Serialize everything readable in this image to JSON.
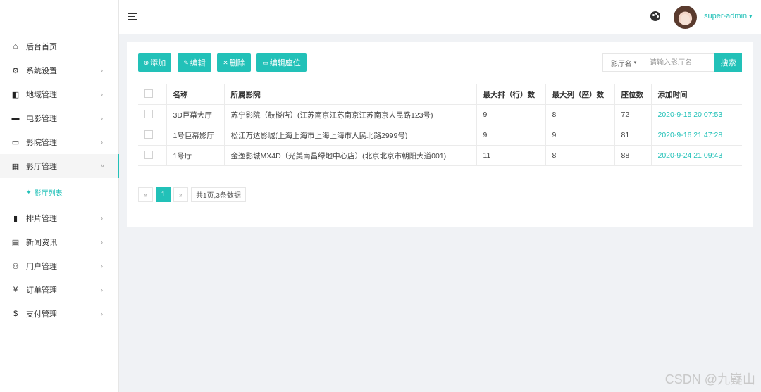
{
  "header": {
    "username": "super-admin",
    "username_caret": "▾"
  },
  "sidebar": {
    "items": [
      {
        "icon": "home-icon",
        "glyph": "⌂",
        "label": "后台首页",
        "arrow": ""
      },
      {
        "icon": "gear-icon",
        "glyph": "⚙",
        "label": "系统设置",
        "arrow": "›"
      },
      {
        "icon": "map-icon",
        "glyph": "◧",
        "label": "地域管理",
        "arrow": "›"
      },
      {
        "icon": "film-icon",
        "glyph": "▬",
        "label": "电影管理",
        "arrow": "›"
      },
      {
        "icon": "cinema-icon",
        "glyph": "▭",
        "label": "影院管理",
        "arrow": "›"
      },
      {
        "icon": "hall-icon",
        "glyph": "▦",
        "label": "影厅管理",
        "arrow": "˅"
      },
      {
        "icon": "schedule-icon",
        "glyph": "▮",
        "label": "排片管理",
        "arrow": "›"
      },
      {
        "icon": "news-icon",
        "glyph": "▤",
        "label": "新闻资讯",
        "arrow": "›"
      },
      {
        "icon": "users-icon",
        "glyph": "⚇",
        "label": "用户管理",
        "arrow": "›"
      },
      {
        "icon": "yen-icon",
        "glyph": "¥",
        "label": "订单管理",
        "arrow": "›"
      },
      {
        "icon": "dollar-icon",
        "glyph": "$",
        "label": "支付管理",
        "arrow": "›"
      }
    ],
    "submenu": {
      "icon": "hall-list-icon",
      "glyph": "✦",
      "label": "影厅列表"
    }
  },
  "toolbar": {
    "add_label": "添加",
    "edit_label": "编辑",
    "delete_label": "删除",
    "edit_seats_label": "编辑座位"
  },
  "search": {
    "field_select": "影厅名",
    "field_caret": "▾",
    "placeholder": "请输入影厅名",
    "button_label": "搜索"
  },
  "table": {
    "columns": [
      "名称",
      "所属影院",
      "最大排（行）数",
      "最大列（座）数",
      "座位数",
      "添加时间"
    ],
    "rows": [
      [
        "3D巨幕大厅",
        "苏宁影院（鼓楼店）(江苏南京江苏南京江苏南京人民路123号)",
        "9",
        "8",
        "72",
        "2020-9-15 20:07:53"
      ],
      [
        "1号巨幕影厅",
        "松江万达影城(上海上海市上海上海市人民北路2999号)",
        "9",
        "9",
        "81",
        "2020-9-16 21:47:28"
      ],
      [
        "1号厅",
        "金逸影城MX4D（光美南昌绿地中心店）(北京北京市朝阳大道001)",
        "11",
        "8",
        "88",
        "2020-9-24 21:09:43"
      ]
    ]
  },
  "pagination": {
    "prev": "«",
    "current": "1",
    "next": "»",
    "summary": "共1页,3条数据"
  },
  "watermark": "CSDN @九嶷山",
  "colors": {
    "accent": "#22c1b8"
  }
}
